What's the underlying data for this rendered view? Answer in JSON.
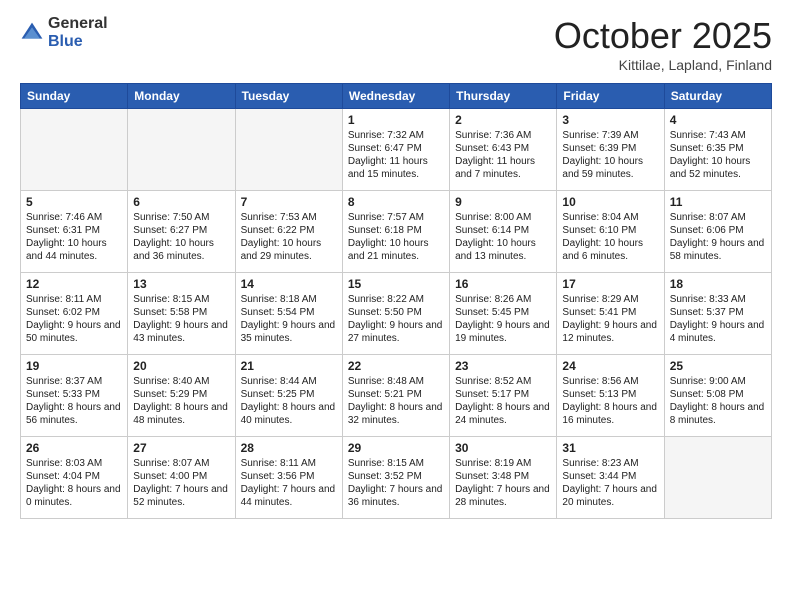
{
  "header": {
    "logo_general": "General",
    "logo_blue": "Blue",
    "title": "October 2025",
    "location": "Kittilae, Lapland, Finland"
  },
  "days_of_week": [
    "Sunday",
    "Monday",
    "Tuesday",
    "Wednesday",
    "Thursday",
    "Friday",
    "Saturday"
  ],
  "weeks": [
    [
      {
        "day": "",
        "empty": true
      },
      {
        "day": "",
        "empty": true
      },
      {
        "day": "",
        "empty": true
      },
      {
        "day": "1",
        "rise": "7:32 AM",
        "set": "6:47 PM",
        "daylight": "11 hours and 15 minutes."
      },
      {
        "day": "2",
        "rise": "7:36 AM",
        "set": "6:43 PM",
        "daylight": "11 hours and 7 minutes."
      },
      {
        "day": "3",
        "rise": "7:39 AM",
        "set": "6:39 PM",
        "daylight": "10 hours and 59 minutes."
      },
      {
        "day": "4",
        "rise": "7:43 AM",
        "set": "6:35 PM",
        "daylight": "10 hours and 52 minutes."
      }
    ],
    [
      {
        "day": "5",
        "rise": "7:46 AM",
        "set": "6:31 PM",
        "daylight": "10 hours and 44 minutes."
      },
      {
        "day": "6",
        "rise": "7:50 AM",
        "set": "6:27 PM",
        "daylight": "10 hours and 36 minutes."
      },
      {
        "day": "7",
        "rise": "7:53 AM",
        "set": "6:22 PM",
        "daylight": "10 hours and 29 minutes."
      },
      {
        "day": "8",
        "rise": "7:57 AM",
        "set": "6:18 PM",
        "daylight": "10 hours and 21 minutes."
      },
      {
        "day": "9",
        "rise": "8:00 AM",
        "set": "6:14 PM",
        "daylight": "10 hours and 13 minutes."
      },
      {
        "day": "10",
        "rise": "8:04 AM",
        "set": "6:10 PM",
        "daylight": "10 hours and 6 minutes."
      },
      {
        "day": "11",
        "rise": "8:07 AM",
        "set": "6:06 PM",
        "daylight": "9 hours and 58 minutes."
      }
    ],
    [
      {
        "day": "12",
        "rise": "8:11 AM",
        "set": "6:02 PM",
        "daylight": "9 hours and 50 minutes."
      },
      {
        "day": "13",
        "rise": "8:15 AM",
        "set": "5:58 PM",
        "daylight": "9 hours and 43 minutes."
      },
      {
        "day": "14",
        "rise": "8:18 AM",
        "set": "5:54 PM",
        "daylight": "9 hours and 35 minutes."
      },
      {
        "day": "15",
        "rise": "8:22 AM",
        "set": "5:50 PM",
        "daylight": "9 hours and 27 minutes."
      },
      {
        "day": "16",
        "rise": "8:26 AM",
        "set": "5:45 PM",
        "daylight": "9 hours and 19 minutes."
      },
      {
        "day": "17",
        "rise": "8:29 AM",
        "set": "5:41 PM",
        "daylight": "9 hours and 12 minutes."
      },
      {
        "day": "18",
        "rise": "8:33 AM",
        "set": "5:37 PM",
        "daylight": "9 hours and 4 minutes."
      }
    ],
    [
      {
        "day": "19",
        "rise": "8:37 AM",
        "set": "5:33 PM",
        "daylight": "8 hours and 56 minutes."
      },
      {
        "day": "20",
        "rise": "8:40 AM",
        "set": "5:29 PM",
        "daylight": "8 hours and 48 minutes."
      },
      {
        "day": "21",
        "rise": "8:44 AM",
        "set": "5:25 PM",
        "daylight": "8 hours and 40 minutes."
      },
      {
        "day": "22",
        "rise": "8:48 AM",
        "set": "5:21 PM",
        "daylight": "8 hours and 32 minutes."
      },
      {
        "day": "23",
        "rise": "8:52 AM",
        "set": "5:17 PM",
        "daylight": "8 hours and 24 minutes."
      },
      {
        "day": "24",
        "rise": "8:56 AM",
        "set": "5:13 PM",
        "daylight": "8 hours and 16 minutes."
      },
      {
        "day": "25",
        "rise": "9:00 AM",
        "set": "5:08 PM",
        "daylight": "8 hours and 8 minutes."
      }
    ],
    [
      {
        "day": "26",
        "rise": "8:03 AM",
        "set": "4:04 PM",
        "daylight": "8 hours and 0 minutes."
      },
      {
        "day": "27",
        "rise": "8:07 AM",
        "set": "4:00 PM",
        "daylight": "7 hours and 52 minutes."
      },
      {
        "day": "28",
        "rise": "8:11 AM",
        "set": "3:56 PM",
        "daylight": "7 hours and 44 minutes."
      },
      {
        "day": "29",
        "rise": "8:15 AM",
        "set": "3:52 PM",
        "daylight": "7 hours and 36 minutes."
      },
      {
        "day": "30",
        "rise": "8:19 AM",
        "set": "3:48 PM",
        "daylight": "7 hours and 28 minutes."
      },
      {
        "day": "31",
        "rise": "8:23 AM",
        "set": "3:44 PM",
        "daylight": "7 hours and 20 minutes."
      },
      {
        "day": "",
        "empty": true
      }
    ]
  ]
}
